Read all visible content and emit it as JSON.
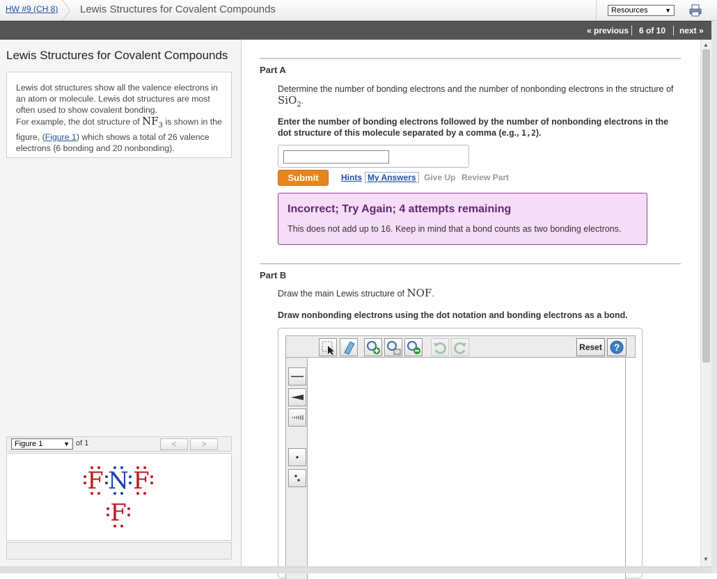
{
  "header": {
    "breadcrumb": "HW #9 (CH 8)",
    "title": "Lewis Structures for Covalent Compounds",
    "resources_label": "Resources"
  },
  "nav": {
    "previous": "« previous",
    "position": "6 of 10",
    "next": "next »"
  },
  "left": {
    "title": "Lewis Structures for Covalent Compounds",
    "intro_1": "Lewis dot structures show all the valence electrons in an atom or molecule. Lewis dot structures are most often used to show covalent bonding.",
    "intro_2a": "For example, the dot structure of ",
    "intro_formula": "NF",
    "intro_sub": "3",
    "intro_2b": " is shown in the figure, (",
    "figure_link": "Figure 1",
    "intro_2c": ") which shows a total of 26 valence electrons (6 bonding and 20 nonbonding).",
    "figure_select": "Figure 1",
    "figure_of": "of 1",
    "figure_prev": "<",
    "figure_next": ">",
    "atoms": {
      "top": [
        "F",
        "N",
        "F"
      ],
      "bottom": "F"
    }
  },
  "partA": {
    "title": "Part A",
    "question_a": "Determine the number of bonding electrons and the number of nonbonding electrons in the structure of ",
    "formula": "SiO",
    "formula_sub": "2",
    "question_b": ".",
    "instruction_a": "Enter the number of bonding electrons followed by the number of nonbonding electrons in the dot structure of this molecule separated by a comma (e.g., ",
    "instruction_example": "1,2",
    "instruction_b": ").",
    "answer_value": "",
    "submit": "Submit",
    "hints": "Hints",
    "my_answers": "My Answers",
    "give_up": "Give Up",
    "review_part": "Review Part",
    "feedback_title": "Incorrect; Try Again; 4 attempts remaining",
    "feedback_body": "This does not add up to 16. Keep in mind that a bond counts as two bonding electrons."
  },
  "partB": {
    "title": "Part B",
    "question_a": "Draw the main Lewis structure of ",
    "formula": "NOF",
    "question_b": ".",
    "instruction": "Draw nonbonding electrons using the dot notation and bonding electrons as a bond.",
    "reset": "Reset",
    "help": "?"
  },
  "colors": {
    "accent_orange": "#e8841c",
    "feedback_bg": "#f5dcf7",
    "feedback_border": "#9b3fa6",
    "link_blue": "#1f4fa0",
    "nitrogen_blue": "#1b3fb5",
    "fluorine_red": "#c0171e"
  }
}
